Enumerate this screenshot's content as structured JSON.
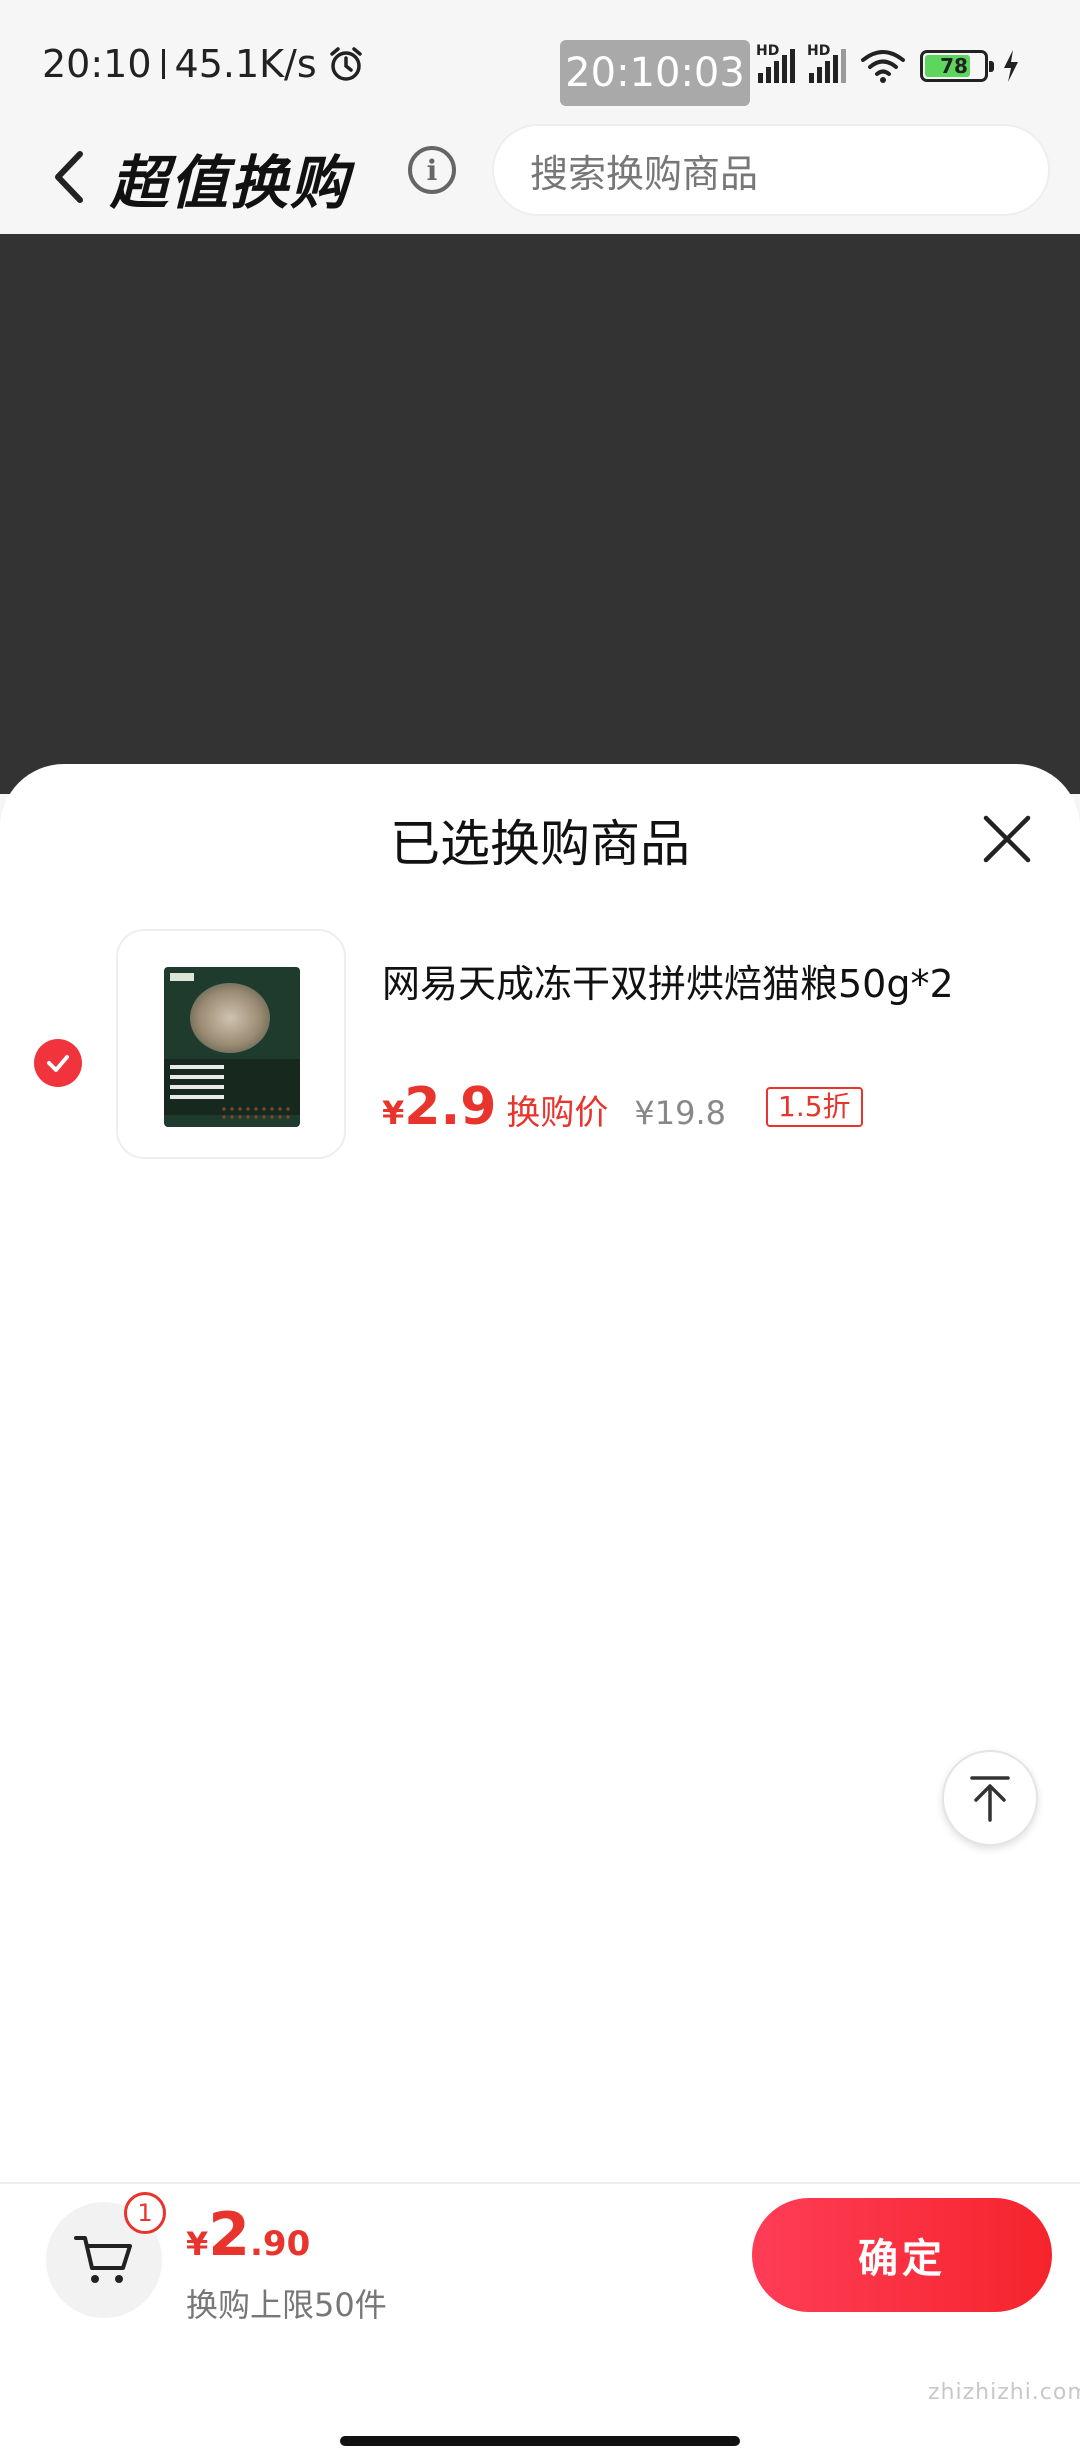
{
  "status_bar": {
    "time": "20:10",
    "speed": "45.1K/s",
    "clock_chip": "20:10:03",
    "hd_label": "HD",
    "battery": "78"
  },
  "header": {
    "title": "超值换购",
    "search_placeholder": "搜索换购商品"
  },
  "sheet": {
    "title": "已选换购商品",
    "items": [
      {
        "name": "网易天成冻干双拼烘焙猫粮50g*2",
        "yen": "¥",
        "price": "2.9",
        "price_label": "换购价",
        "original_price": "¥19.8",
        "discount": "1.5折",
        "selected": true
      }
    ]
  },
  "bottom_bar": {
    "cart_count": "1",
    "total_yen": "¥",
    "total_int": "2",
    "total_dec": ".90",
    "limit_text": "换购上限50件",
    "confirm_label": "确定"
  },
  "colors": {
    "accent": "#e8342c",
    "overlay": "#333333"
  },
  "watermark": "zhizhizhi.com"
}
